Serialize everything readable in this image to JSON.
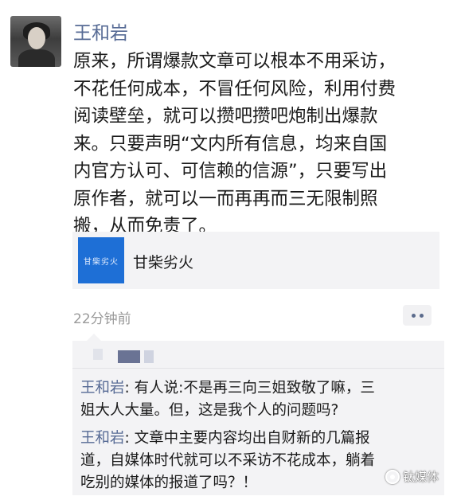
{
  "post": {
    "username": "王和岩",
    "text_lines": [
      "原来，所谓爆款文章可以根本不用采访，",
      "不花任何成本，不冒任何风险，利用付费",
      "阅读壁垒，就可以攒吧攒吧炮制出爆款",
      "来。只要声明“文内所有信息，均来自国",
      "内官方认可、可信赖的信源”，只要写出",
      "原作者，就可以一而再再而三无限制照",
      "搬，从而免责了。"
    ],
    "link_card": {
      "thumb_text": "甘柴劣火",
      "title": "甘柴劣火"
    },
    "timestamp": "22分钟前",
    "more_icon": "more-dots-icon"
  },
  "comments": [
    {
      "author": "王和岩",
      "separator": ": ",
      "first_line": "有人说:不是再三向三姐致敬了嘛，三",
      "rest_lines": [
        "姐大人大量。但，这是我个人的问题吗?"
      ]
    },
    {
      "author": "王和岩",
      "separator": ": ",
      "first_line": "文章中主要内容均出自财新的几篇报",
      "rest_lines": [
        "道，自媒体时代就可以不采访不花成本，躺着",
        "吃别的媒体的报道了吗？！"
      ]
    }
  ],
  "watermark": {
    "text": "钛媒体",
    "icon": "watermark-logo-icon"
  }
}
